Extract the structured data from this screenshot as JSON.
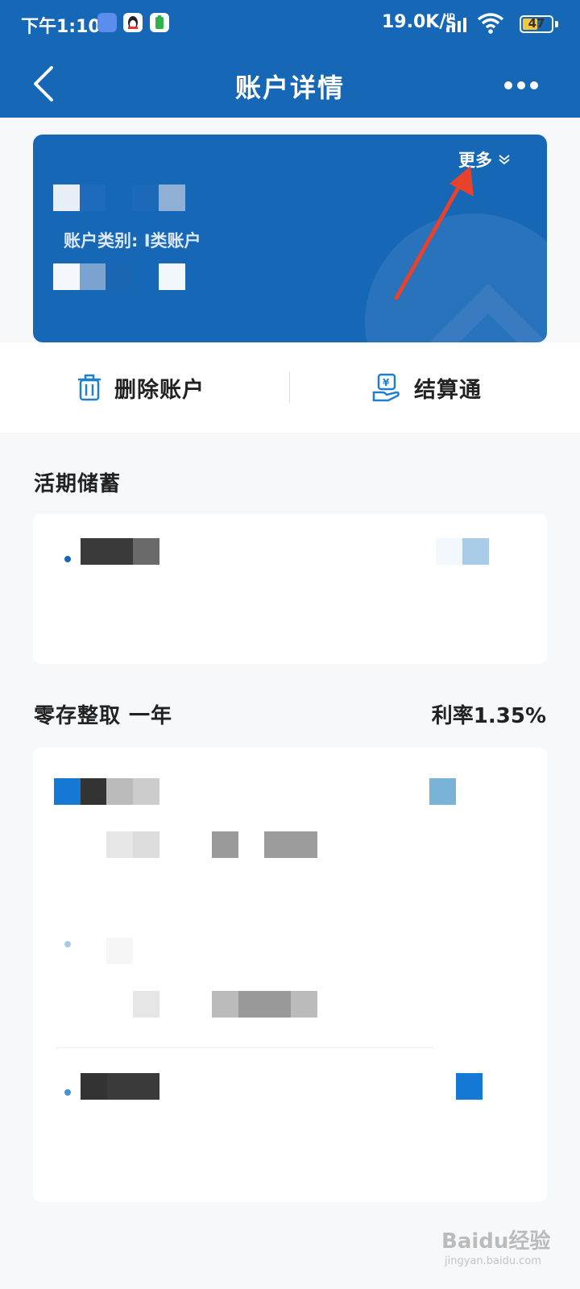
{
  "status_bar": {
    "time": "下午1:10",
    "net_speed": "19.0K/s",
    "battery": "47",
    "icons": [
      "app-notification-icon",
      "qq-icon",
      "battery-app-icon",
      "hd-signal-icon",
      "wifi-icon",
      "battery-icon"
    ]
  },
  "nav": {
    "title": "账户详情",
    "back_icon": "chevron-left-icon",
    "more_icon": "more-dots-icon"
  },
  "account_card": {
    "more_label": "更多",
    "account_type": "账户类别: I类账户",
    "colors": {
      "background": "#1767b7"
    }
  },
  "actions": [
    {
      "label": "删除账户",
      "icon": "trash-icon"
    },
    {
      "label": "结算通",
      "icon": "hand-yuan-icon"
    }
  ],
  "sections": {
    "demand": {
      "title": "活期储蓄"
    },
    "installment": {
      "title": "零存整取  一年",
      "rate": "利率1.35%"
    }
  },
  "watermark": {
    "brand": "Baidu经验",
    "url": "jingyan.baidu.com"
  },
  "colors": {
    "primary": "#1767b7",
    "annotation_arrow": "#e8412c"
  }
}
